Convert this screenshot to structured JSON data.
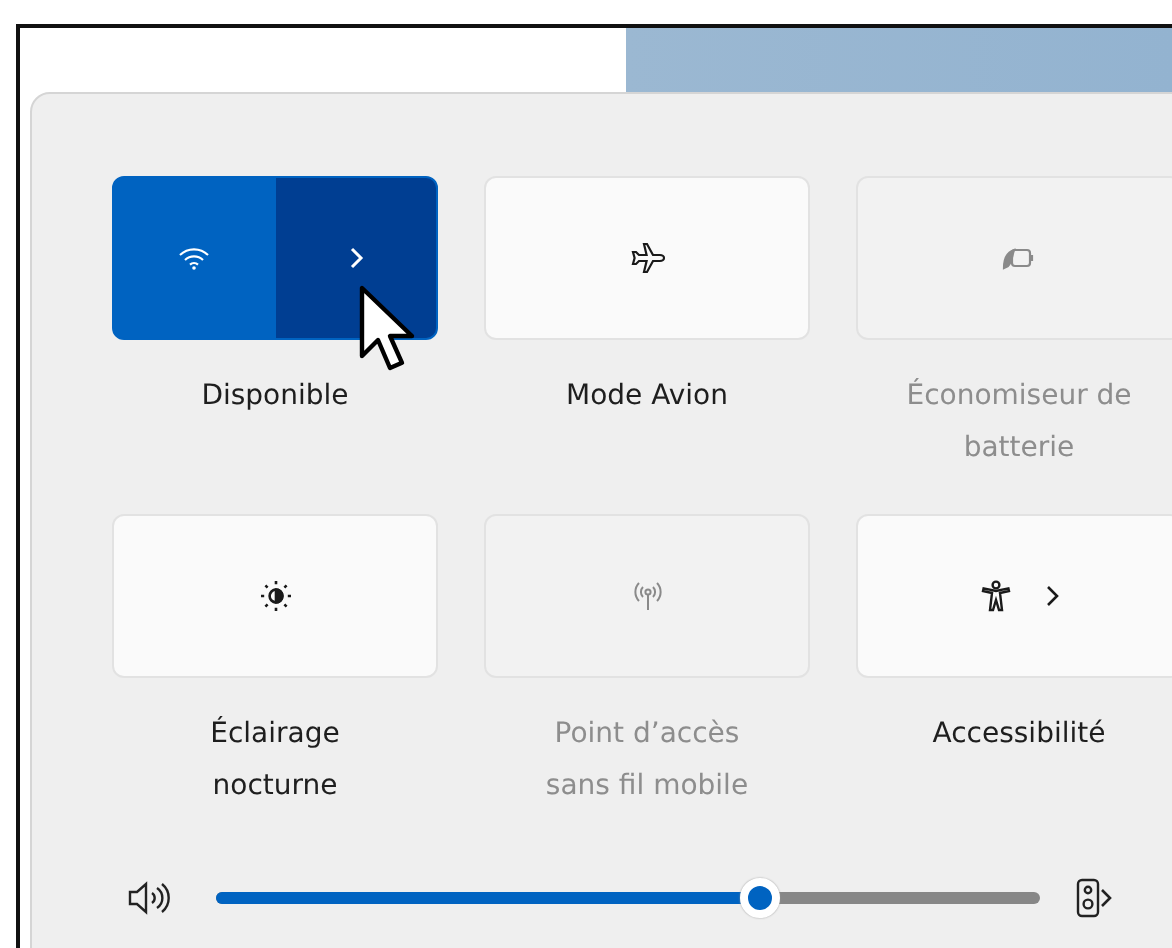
{
  "tiles": [
    {
      "label": "Disponible",
      "on": true,
      "disabled": false,
      "expandable": true
    },
    {
      "label": "Mode Avion",
      "on": false,
      "disabled": false,
      "expandable": false
    },
    {
      "label": "Économiseur de batterie",
      "on": false,
      "disabled": true,
      "expandable": false
    },
    {
      "label": "Éclairage nocturne",
      "on": false,
      "disabled": false,
      "expandable": false
    },
    {
      "label": "Point d’accès sans fil mobile",
      "on": false,
      "disabled": true,
      "expandable": false
    },
    {
      "label": "Accessibilité",
      "on": false,
      "disabled": false,
      "expandable": true
    }
  ],
  "volume": {
    "level": 0.66
  }
}
